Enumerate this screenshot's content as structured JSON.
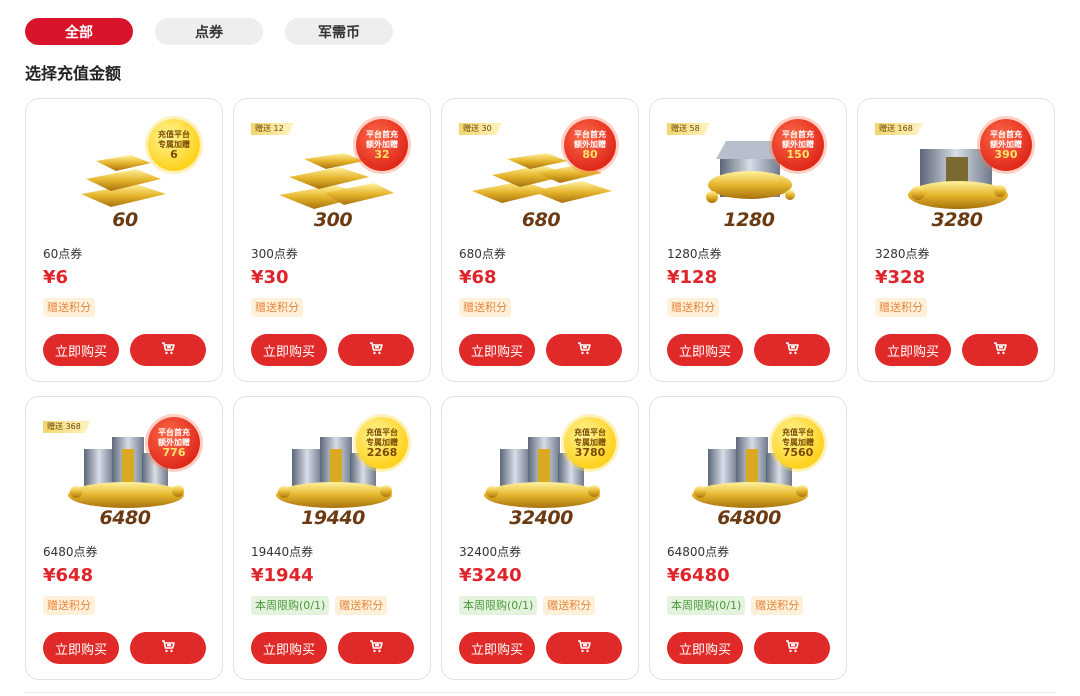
{
  "tabs": [
    {
      "label": "全部",
      "active": true
    },
    {
      "label": "点券",
      "active": false
    },
    {
      "label": "军需币",
      "active": false
    }
  ],
  "section_title": "选择充值金额",
  "buy_label": "立即购买",
  "points_label": "赠送积分",
  "limit_label": "本周限购(0/1)",
  "cards": [
    {
      "amount": "60",
      "name": "60点券",
      "price": "¥6",
      "gift": "",
      "badge": {
        "style": "yellow",
        "l1": "充值平台",
        "l2": "专属加赠",
        "amt": "6"
      },
      "tags": [
        "points"
      ],
      "art": "bars-small"
    },
    {
      "amount": "300",
      "name": "300点券",
      "price": "¥30",
      "gift": "赠送 12",
      "badge": {
        "style": "red",
        "l1": "平台首充",
        "l2": "额外加赠",
        "amt": "32"
      },
      "tags": [
        "points"
      ],
      "art": "bars-medium"
    },
    {
      "amount": "680",
      "name": "680点券",
      "price": "¥68",
      "gift": "赠送 30",
      "badge": {
        "style": "red",
        "l1": "平台首充",
        "l2": "额外加赠",
        "amt": "80"
      },
      "tags": [
        "points"
      ],
      "art": "bars-large"
    },
    {
      "amount": "1280",
      "name": "1280点券",
      "price": "¥128",
      "gift": "赠送 58",
      "badge": {
        "style": "red",
        "l1": "平台首充",
        "l2": "额外加赠",
        "amt": "150"
      },
      "tags": [
        "points"
      ],
      "art": "chest"
    },
    {
      "amount": "3280",
      "name": "3280点券",
      "price": "¥328",
      "gift": "赠送 168",
      "badge": {
        "style": "red",
        "l1": "平台首充",
        "l2": "额外加赠",
        "amt": "390"
      },
      "tags": [
        "points"
      ],
      "art": "vault"
    },
    {
      "amount": "6480",
      "name": "6480点券",
      "price": "¥648",
      "gift": "赠送 368",
      "badge": {
        "style": "red",
        "l1": "平台首充",
        "l2": "额外加赠",
        "amt": "776"
      },
      "tags": [
        "points"
      ],
      "art": "buildings"
    },
    {
      "amount": "19440",
      "name": "19440点券",
      "price": "¥1944",
      "gift": "",
      "badge": {
        "style": "yellow",
        "l1": "充值平台",
        "l2": "专属加赠",
        "amt": "2268"
      },
      "tags": [
        "limit",
        "points"
      ],
      "art": "buildings"
    },
    {
      "amount": "32400",
      "name": "32400点券",
      "price": "¥3240",
      "gift": "",
      "badge": {
        "style": "yellow",
        "l1": "充值平台",
        "l2": "专属加赠",
        "amt": "3780"
      },
      "tags": [
        "limit",
        "points"
      ],
      "art": "buildings"
    },
    {
      "amount": "64800",
      "name": "64800点券",
      "price": "¥6480",
      "gift": "",
      "badge": {
        "style": "yellow",
        "l1": "充值平台",
        "l2": "专属加赠",
        "amt": "7560"
      },
      "tags": [
        "limit",
        "points"
      ],
      "art": "buildings"
    }
  ],
  "colors": {
    "accent": "#e02a2a",
    "tab_active": "#d8142b",
    "points_tag": "#e8843a",
    "limit_tag": "#4d9a3c"
  },
  "icons": {
    "cart": "shopping-cart-icon",
    "coupon": "coupon-icon"
  }
}
